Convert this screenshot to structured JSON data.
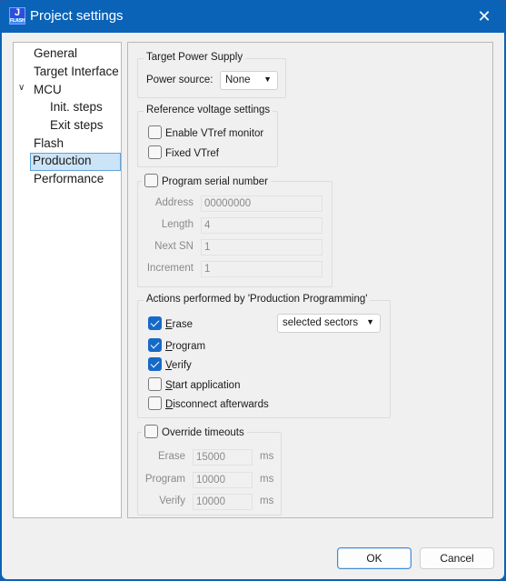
{
  "window": {
    "title": "Project settings",
    "app_icon": {
      "letter": "J",
      "caption": "FLASH"
    },
    "close_icon": "close-icon"
  },
  "sidebar": {
    "items": [
      {
        "label": "General",
        "level": 0,
        "selected": false
      },
      {
        "label": "Target Interface",
        "level": 0,
        "selected": false
      },
      {
        "label": "MCU",
        "level": 0,
        "expanded": true,
        "selected": false
      },
      {
        "label": "Init. steps",
        "level": 1,
        "selected": false
      },
      {
        "label": "Exit steps",
        "level": 1,
        "selected": false
      },
      {
        "label": "Flash",
        "level": 0,
        "selected": false
      },
      {
        "label": "Production",
        "level": 0,
        "selected": true
      },
      {
        "label": "Performance",
        "level": 0,
        "selected": false
      }
    ],
    "expand_glyph": "⌄"
  },
  "power": {
    "group_label": "Target Power Supply",
    "source_label": "Power source:",
    "source_value": "None"
  },
  "vref": {
    "group_label": "Reference voltage settings",
    "enable_monitor": {
      "label": "Enable VTref monitor",
      "checked": false
    },
    "fixed": {
      "label": "Fixed VTref",
      "checked": false
    }
  },
  "serial": {
    "group_label": "Program serial number",
    "checked": false,
    "fields": [
      {
        "label": "Address",
        "value": "00000000"
      },
      {
        "label": "Length",
        "value": "4"
      },
      {
        "label": "Next SN",
        "value": "1"
      },
      {
        "label": "Increment",
        "value": "1"
      }
    ]
  },
  "actions": {
    "group_label": "Actions performed by 'Production Programming'",
    "items": [
      {
        "label": "Erase",
        "mnemonic": "E",
        "rest": "rase",
        "checked": true
      },
      {
        "label": "Program",
        "mnemonic": "P",
        "rest": "rogram",
        "checked": true
      },
      {
        "label": "Verify",
        "mnemonic": "V",
        "rest": "erify",
        "checked": true
      },
      {
        "label": "Start application",
        "mnemonic": "S",
        "rest": "tart application",
        "checked": false
      },
      {
        "label": "Disconnect afterwards",
        "mnemonic": "D",
        "rest": "isconnect afterwards",
        "checked": false
      }
    ],
    "erase_mode": "selected sectors"
  },
  "timeouts": {
    "group_label": "Override timeouts",
    "checked": false,
    "unit": "ms",
    "fields": [
      {
        "label": "Erase",
        "value": "15000"
      },
      {
        "label": "Program",
        "value": "10000"
      },
      {
        "label": "Verify",
        "value": "10000"
      }
    ]
  },
  "buttons": {
    "ok": "OK",
    "cancel": "Cancel"
  },
  "colors": {
    "titlebar": "#0b63b7",
    "checkbox_checked": "#1769c8",
    "selection": "#cce4f7"
  }
}
